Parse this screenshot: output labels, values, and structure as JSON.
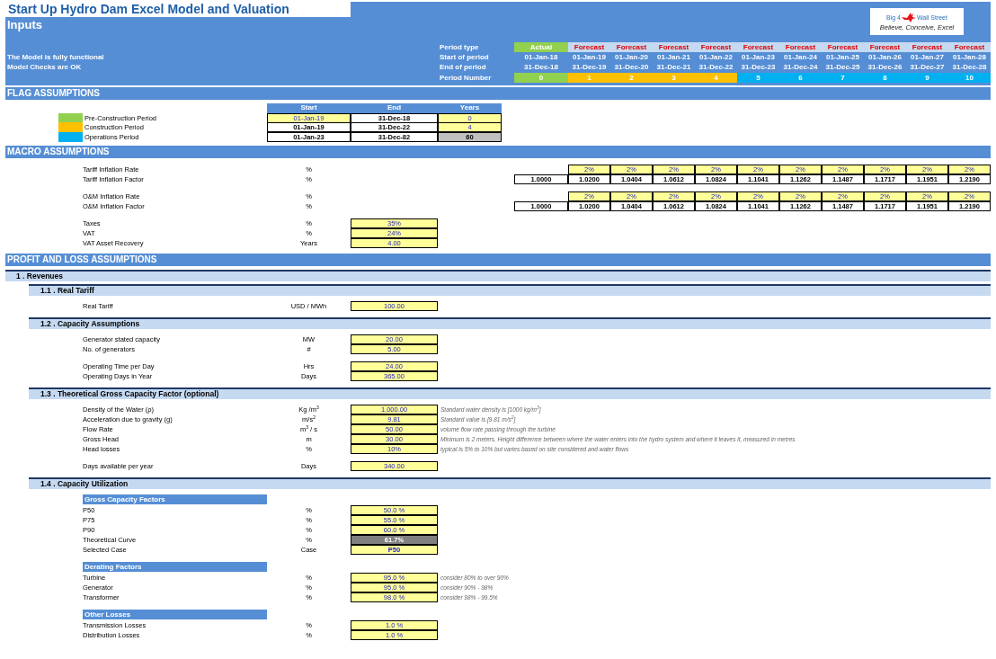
{
  "title": "Start Up Hydro Dam Excel Model and Valuation",
  "sheet": "Inputs",
  "status": [
    "The Model is fully functional",
    "Model Checks are OK"
  ],
  "logo": {
    "left": "Big 4",
    "right": "Wall Street",
    "tagline": "Believe, Conceive, Excel"
  },
  "period_labels": [
    "Period type",
    "Start of period",
    "End of period",
    "Period Number"
  ],
  "periods": [
    {
      "type": "Actual",
      "start": "01-Jan-18",
      "end": "31-Dec-18",
      "number": "0",
      "kind": "actual",
      "color": "#92d050"
    },
    {
      "type": "Forecast",
      "start": "01-Jan-19",
      "end": "31-Dec-19",
      "number": "1",
      "kind": "forecast",
      "color": "#ffc000"
    },
    {
      "type": "Forecast",
      "start": "01-Jan-20",
      "end": "31-Dec-20",
      "number": "2",
      "kind": "forecast",
      "color": "#ffc000"
    },
    {
      "type": "Forecast",
      "start": "01-Jan-21",
      "end": "31-Dec-21",
      "number": "3",
      "kind": "forecast",
      "color": "#ffc000"
    },
    {
      "type": "Forecast",
      "start": "01-Jan-22",
      "end": "31-Dec-22",
      "number": "4",
      "kind": "forecast",
      "color": "#ffc000"
    },
    {
      "type": "Forecast",
      "start": "01-Jan-23",
      "end": "31-Dec-23",
      "number": "5",
      "kind": "forecast",
      "color": "#00b0f0"
    },
    {
      "type": "Forecast",
      "start": "01-Jan-24",
      "end": "31-Dec-24",
      "number": "6",
      "kind": "forecast",
      "color": "#00b0f0"
    },
    {
      "type": "Forecast",
      "start": "01-Jan-25",
      "end": "31-Dec-25",
      "number": "7",
      "kind": "forecast",
      "color": "#00b0f0"
    },
    {
      "type": "Forecast",
      "start": "01-Jan-26",
      "end": "31-Dec-26",
      "number": "8",
      "kind": "forecast",
      "color": "#00b0f0"
    },
    {
      "type": "Forecast",
      "start": "01-Jan-27",
      "end": "31-Dec-27",
      "number": "9",
      "kind": "forecast",
      "color": "#00b0f0"
    },
    {
      "type": "Forecast",
      "start": "01-Jan-28",
      "end": "31-Dec-28",
      "number": "10",
      "kind": "forecast",
      "color": "#00b0f0"
    }
  ],
  "flags": {
    "heading": "FLAG ASSUMPTIONS",
    "columns": [
      "Start",
      "End",
      "Years"
    ],
    "rows": [
      {
        "label": "Pre-Construction Period",
        "color": "#92d050",
        "cells": [
          {
            "value": "01-Jan-19",
            "kind": "input"
          },
          {
            "value": "31-Dec-18",
            "kind": "output"
          },
          {
            "value": "0",
            "kind": "input"
          }
        ]
      },
      {
        "label": "Construction Period",
        "color": "#ffc000",
        "cells": [
          {
            "value": "01-Jan-19",
            "kind": "output"
          },
          {
            "value": "31-Dec-22",
            "kind": "output"
          },
          {
            "value": "4",
            "kind": "input"
          }
        ]
      },
      {
        "label": "Operations Period",
        "color": "#00b0f0",
        "cells": [
          {
            "value": "01-Jan-23",
            "kind": "output"
          },
          {
            "value": "31-Dec-82",
            "kind": "output"
          },
          {
            "value": "60",
            "kind": "shaded"
          }
        ]
      }
    ]
  },
  "macro": {
    "heading": "MACRO ASSUMPTIONS",
    "groups": [
      {
        "rows": [
          {
            "kind": "input_series",
            "label": "Tariff Inflation Rate",
            "unit": "%",
            "values": [
              "2%",
              "2%",
              "2%",
              "2%",
              "2%",
              "2%",
              "2%",
              "2%",
              "2%",
              "2%"
            ]
          },
          {
            "kind": "output_series",
            "label": "Tariff Inflation Factor",
            "unit": "%",
            "values": [
              "1.0000",
              "1.0200",
              "1.0404",
              "1.0612",
              "1.0824",
              "1.1041",
              "1.1262",
              "1.1487",
              "1.1717",
              "1.1951",
              "1.2190"
            ]
          }
        ]
      },
      {
        "rows": [
          {
            "kind": "input_series",
            "label": "O&M Inflation Rate",
            "unit": "%",
            "values": [
              "2%",
              "2%",
              "2%",
              "2%",
              "2%",
              "2%",
              "2%",
              "2%",
              "2%",
              "2%"
            ]
          },
          {
            "kind": "output_series",
            "label": "O&M Inflation Factor",
            "unit": "%",
            "values": [
              "1.0000",
              "1.0200",
              "1.0404",
              "1.0612",
              "1.0824",
              "1.1041",
              "1.1262",
              "1.1487",
              "1.1717",
              "1.1951",
              "1.2190"
            ]
          }
        ]
      },
      {
        "rows": [
          {
            "kind": "value",
            "label": "Taxes",
            "unit": "%",
            "cell": {
              "value": "35%",
              "kind": "input"
            }
          },
          {
            "kind": "value",
            "label": "VAT",
            "unit": "%",
            "cell": {
              "value": "24%",
              "kind": "input"
            }
          },
          {
            "kind": "value",
            "label": "VAT Asset Recovery",
            "unit": "Years",
            "cell": {
              "value": "4.00",
              "kind": "input"
            }
          }
        ]
      }
    ]
  },
  "pnl": {
    "heading": "PROFIT AND LOSS ASSUMPTIONS",
    "sections": [
      {
        "title": "1 . Revenues",
        "subsections": [
          {
            "title": "1.1 . Real Tariff",
            "groups": [
              {
                "rows": [
                  {
                    "kind": "value",
                    "label": "Real Tariff",
                    "unit": "USD / MWh",
                    "cell": {
                      "value": "100.00",
                      "kind": "input"
                    }
                  }
                ]
              }
            ]
          },
          {
            "title": "1.2 . Capacity Assumptions",
            "groups": [
              {
                "rows": [
                  {
                    "kind": "value",
                    "label": "Generator stated capacity",
                    "unit": "MW",
                    "cell": {
                      "value": "20.00",
                      "kind": "input"
                    }
                  },
                  {
                    "kind": "value",
                    "label": "No. of generators",
                    "unit": "#",
                    "cell": {
                      "value": "5.00",
                      "kind": "input"
                    }
                  }
                ]
              },
              {
                "rows": [
                  {
                    "kind": "value",
                    "label": "Operating Time per Day",
                    "unit": "Hrs",
                    "cell": {
                      "value": "24.00",
                      "kind": "input"
                    }
                  },
                  {
                    "kind": "value",
                    "label": "Operating Days in Year",
                    "unit": "Days",
                    "cell": {
                      "value": "365.00",
                      "kind": "input"
                    }
                  }
                ]
              }
            ]
          },
          {
            "title": "1.3 . Theoretical Gross Capacity Factor (optional)",
            "groups": [
              {
                "rows": [
                  {
                    "kind": "value",
                    "label": "Density of the Water (ρ)",
                    "unit": "Kg /m$^{3}$",
                    "cell": {
                      "value": "1,000.00",
                      "kind": "input"
                    },
                    "note": "Standard water density is [1000 kg/m$^{3}$]"
                  },
                  {
                    "kind": "value",
                    "label": "Acceleration due to gravity (g)",
                    "unit": "m/s$^{2}$",
                    "cell": {
                      "value": "9.81",
                      "kind": "input"
                    },
                    "note": "Standard value is [9.81 m/s$^{2}$]"
                  },
                  {
                    "kind": "value",
                    "label": "Flow Rate",
                    "unit": "m$^{3}$ / s",
                    "cell": {
                      "value": "50.00",
                      "kind": "input"
                    },
                    "note": "volume flow rate passing through the turbine"
                  },
                  {
                    "kind": "value",
                    "label": "Gross Head",
                    "unit": "m",
                    "cell": {
                      "value": "30.00",
                      "kind": "input"
                    },
                    "note": "Minimum is 2 meters. Height difference between where the water enters into the hydro system and where it leaves it, measured in metres"
                  },
                  {
                    "kind": "value",
                    "label": "Head losses",
                    "unit": "%",
                    "cell": {
                      "value": "10%",
                      "kind": "input"
                    },
                    "note": "typical is 5% to 10% but varies based on site considered and water flows"
                  }
                ]
              },
              {
                "rows": [
                  {
                    "kind": "value",
                    "label": "Days available per year",
                    "unit": "Days",
                    "cell": {
                      "value": "340.00",
                      "kind": "input"
                    }
                  }
                ]
              }
            ]
          },
          {
            "title": "1.4 . Capacity Utilization",
            "groups": [
              {
                "heading": "Gross Capacity Factors",
                "rows": [
                  {
                    "kind": "value",
                    "label": "P50",
                    "unit": "%",
                    "cell": {
                      "value": "50.0 %",
                      "kind": "input"
                    }
                  },
                  {
                    "kind": "value",
                    "label": "P75",
                    "unit": "%",
                    "cell": {
                      "value": "55.0 %",
                      "kind": "input"
                    }
                  },
                  {
                    "kind": "value",
                    "label": "P90",
                    "unit": "%",
                    "cell": {
                      "value": "60.0 %",
                      "kind": "input"
                    }
                  },
                  {
                    "kind": "value",
                    "label": "Theoretical Curve",
                    "unit": "%",
                    "cell": {
                      "value": "61.7%",
                      "kind": "highlight"
                    }
                  },
                  {
                    "kind": "value",
                    "label": "Selected Case",
                    "unit": "Case",
                    "cell": {
                      "value": "P50",
                      "kind": "selector"
                    }
                  }
                ]
              },
              {
                "heading": "Derating Factors",
                "rows": [
                  {
                    "kind": "value",
                    "label": "Turbine",
                    "unit": "%",
                    "cell": {
                      "value": "95.0 %",
                      "kind": "input"
                    },
                    "note": "consider 80% to over 90%"
                  },
                  {
                    "kind": "value",
                    "label": "Generator",
                    "unit": "%",
                    "cell": {
                      "value": "95.0 %",
                      "kind": "input"
                    },
                    "note": "consider 90% - 98%"
                  },
                  {
                    "kind": "value",
                    "label": "Transformer",
                    "unit": "%",
                    "cell": {
                      "value": "98.0 %",
                      "kind": "input"
                    },
                    "note": "consider 98% - 99.5%"
                  }
                ]
              },
              {
                "heading": "Other Losses",
                "rows": [
                  {
                    "kind": "value",
                    "label": "Transmission Losses",
                    "unit": "%",
                    "cell": {
                      "value": "1.0 %",
                      "kind": "input"
                    }
                  },
                  {
                    "kind": "value",
                    "label": "Distribution Losses",
                    "unit": "%",
                    "cell": {
                      "value": "1.0 %",
                      "kind": "input"
                    }
                  }
                ]
              }
            ]
          }
        ]
      }
    ]
  }
}
